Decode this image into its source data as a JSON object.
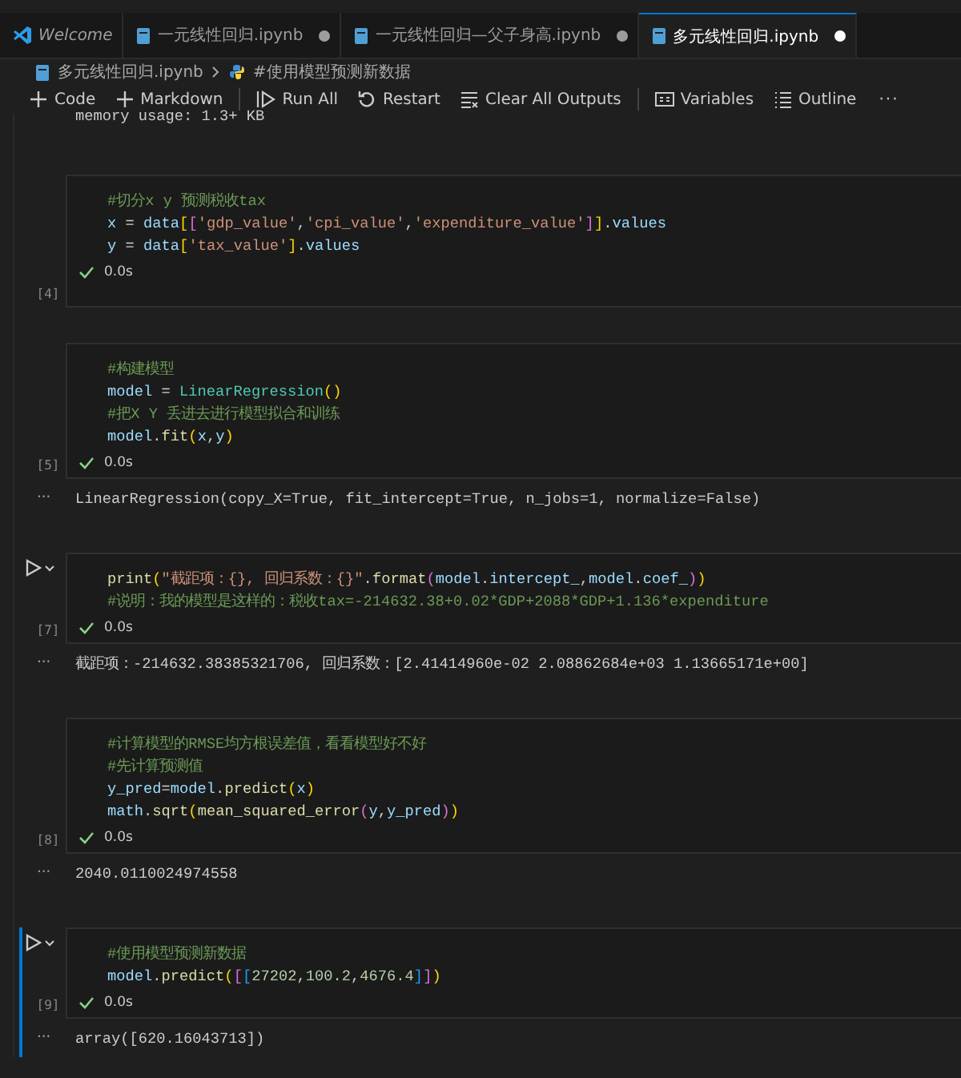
{
  "tabs": [
    {
      "label": "Welcome",
      "selected": false,
      "preview": true,
      "modified": false
    },
    {
      "label": "一元线性回归.ipynb",
      "selected": false,
      "preview": false,
      "modified": true
    },
    {
      "label": "一元线性回归—父子身高.ipynb",
      "selected": false,
      "preview": false,
      "modified": true
    },
    {
      "label": "多元线性回归.ipynb",
      "selected": true,
      "preview": false,
      "modified": true
    }
  ],
  "breadcrumb": [
    "多元线性回归.ipynb",
    "#使用模型预测新数据"
  ],
  "toolbar": [
    {
      "label": "Code",
      "separator_before": false
    },
    {
      "label": "Markdown",
      "separator_before": false
    },
    {
      "label": "Run All",
      "separator_before": true
    },
    {
      "label": "Restart",
      "separator_before": false
    },
    {
      "label": "Clear All Outputs",
      "separator_before": false
    },
    {
      "label": "Variables",
      "separator_before": true
    },
    {
      "label": "Outline",
      "separator_before": false
    }
  ],
  "toolbar_more": "···",
  "previous_output": "memory usage: 1.3+ KB",
  "cells": [
    {
      "count": "[4]",
      "focused": false,
      "show_run": false,
      "time": "0.0s",
      "lines": [
        [
          {
            "text": "#切分x y 预测税收tax",
            "kind": "c"
          }
        ],
        [
          {
            "text": "x",
            "kind": "v"
          },
          {
            "text": " = ",
            "kind": "p"
          },
          {
            "text": "data",
            "kind": "v"
          },
          {
            "text": "[",
            "kind": "b1"
          },
          {
            "text": "[",
            "kind": "b2"
          },
          {
            "text": "'gdp_value'",
            "kind": "s"
          },
          {
            "text": ",",
            "kind": "p"
          },
          {
            "text": "'cpi_value'",
            "kind": "s"
          },
          {
            "text": ",",
            "kind": "p"
          },
          {
            "text": "'expenditure_value'",
            "kind": "s"
          },
          {
            "text": "]",
            "kind": "b2"
          },
          {
            "text": "]",
            "kind": "b1"
          },
          {
            "text": ".",
            "kind": "p"
          },
          {
            "text": "values",
            "kind": "v"
          }
        ],
        [
          {
            "text": "y",
            "kind": "v"
          },
          {
            "text": " = ",
            "kind": "p"
          },
          {
            "text": "data",
            "kind": "v"
          },
          {
            "text": "[",
            "kind": "b1"
          },
          {
            "text": "'tax_value'",
            "kind": "s"
          },
          {
            "text": "]",
            "kind": "b1"
          },
          {
            "text": ".",
            "kind": "p"
          },
          {
            "text": "values",
            "kind": "v"
          }
        ]
      ]
    },
    {
      "count": "[5]",
      "focused": false,
      "show_run": false,
      "time": "0.0s",
      "lines": [
        [
          {
            "text": "#构建模型",
            "kind": "c"
          }
        ],
        [
          {
            "text": "model",
            "kind": "v"
          },
          {
            "text": " = ",
            "kind": "p"
          },
          {
            "text": "LinearRegression",
            "kind": "cls"
          },
          {
            "text": "()",
            "kind": "b1"
          }
        ],
        [
          {
            "text": "#把X Y 丢进去进行模型拟合和训练",
            "kind": "c"
          }
        ],
        [
          {
            "text": "model",
            "kind": "v"
          },
          {
            "text": ".",
            "kind": "p"
          },
          {
            "text": "fit",
            "kind": "f"
          },
          {
            "text": "(",
            "kind": "b1"
          },
          {
            "text": "x",
            "kind": "v"
          },
          {
            "text": ",",
            "kind": "p"
          },
          {
            "text": "y",
            "kind": "v"
          },
          {
            "text": ")",
            "kind": "b1"
          }
        ]
      ],
      "output": {
        "more": "···",
        "text": "LinearRegression(copy_X=True, fit_intercept=True, n_jobs=1, normalize=False)"
      }
    },
    {
      "count": "[7]",
      "focused": false,
      "show_run": true,
      "time": "0.0s",
      "lines": [
        [
          {
            "text": "print",
            "kind": "f"
          },
          {
            "text": "(",
            "kind": "b1"
          },
          {
            "text": "\"截距项：{}, 回归系数：{}\"",
            "kind": "s"
          },
          {
            "text": ".",
            "kind": "p"
          },
          {
            "text": "format",
            "kind": "f"
          },
          {
            "text": "(",
            "kind": "b2"
          },
          {
            "text": "model",
            "kind": "v"
          },
          {
            "text": ".",
            "kind": "p"
          },
          {
            "text": "intercept_",
            "kind": "v"
          },
          {
            "text": ",",
            "kind": "p"
          },
          {
            "text": "model",
            "kind": "v"
          },
          {
            "text": ".",
            "kind": "p"
          },
          {
            "text": "coef_",
            "kind": "v"
          },
          {
            "text": ")",
            "kind": "b2"
          },
          {
            "text": ")",
            "kind": "b1"
          }
        ],
        [
          {
            "text": "#说明：我的模型是这样的：税收tax=-214632.38+0.02*GDP+2088*GDP+1.136*expenditure",
            "kind": "c"
          }
        ]
      ],
      "output": {
        "more": "···",
        "text": "截距项：-214632.38385321706, 回归系数：[2.41414960e-02 2.08862684e+03 1.13665171e+00]"
      }
    },
    {
      "count": "[8]",
      "focused": false,
      "show_run": false,
      "time": "0.0s",
      "lines": [
        [
          {
            "text": "#计算模型的RMSE均方根误差值，看看模型好不好",
            "kind": "c"
          }
        ],
        [
          {
            "text": "#先计算预测值",
            "kind": "c"
          }
        ],
        [
          {
            "text": "y_pred",
            "kind": "v"
          },
          {
            "text": "=",
            "kind": "p"
          },
          {
            "text": "model",
            "kind": "v"
          },
          {
            "text": ".",
            "kind": "p"
          },
          {
            "text": "predict",
            "kind": "f"
          },
          {
            "text": "(",
            "kind": "b1"
          },
          {
            "text": "x",
            "kind": "v"
          },
          {
            "text": ")",
            "kind": "b1"
          }
        ],
        [
          {
            "text": "math",
            "kind": "v"
          },
          {
            "text": ".",
            "kind": "p"
          },
          {
            "text": "sqrt",
            "kind": "f"
          },
          {
            "text": "(",
            "kind": "b1"
          },
          {
            "text": "mean_squared_error",
            "kind": "f"
          },
          {
            "text": "(",
            "kind": "b2"
          },
          {
            "text": "y",
            "kind": "v"
          },
          {
            "text": ",",
            "kind": "p"
          },
          {
            "text": "y_pred",
            "kind": "v"
          },
          {
            "text": ")",
            "kind": "b2"
          },
          {
            "text": ")",
            "kind": "b1"
          }
        ]
      ],
      "output": {
        "more": "···",
        "text": "2040.0110024974558"
      }
    },
    {
      "count": "[9]",
      "focused": true,
      "show_run": true,
      "time": "0.0s",
      "lines": [
        [
          {
            "text": "#使用模型预测新数据",
            "kind": "c"
          }
        ],
        [
          {
            "text": "model",
            "kind": "v"
          },
          {
            "text": ".",
            "kind": "p"
          },
          {
            "text": "predict",
            "kind": "f"
          },
          {
            "text": "(",
            "kind": "b1"
          },
          {
            "text": "[",
            "kind": "b2"
          },
          {
            "text": "[",
            "kind": "b3"
          },
          {
            "text": "27202",
            "kind": "n"
          },
          {
            "text": ",",
            "kind": "p"
          },
          {
            "text": "100.2",
            "kind": "n"
          },
          {
            "text": ",",
            "kind": "p"
          },
          {
            "text": "4676.4",
            "kind": "n"
          },
          {
            "text": "]",
            "kind": "b3"
          },
          {
            "text": "]",
            "kind": "b2"
          },
          {
            "text": ")",
            "kind": "b1"
          }
        ]
      ],
      "output": {
        "more": "···",
        "text": "array([620.16043713])"
      }
    }
  ]
}
